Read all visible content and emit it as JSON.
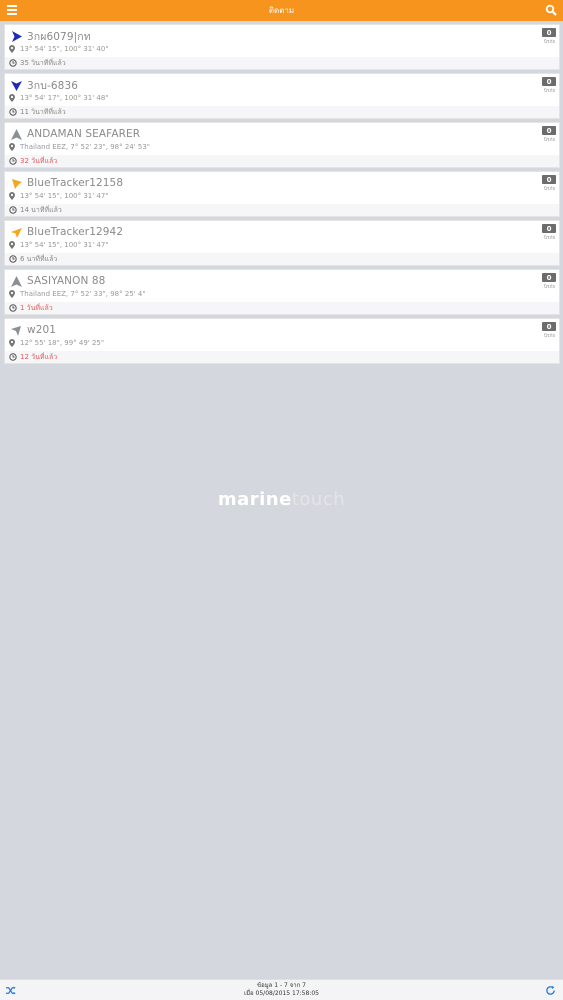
{
  "header": {
    "title": "ติดตาม"
  },
  "vessels": [
    {
      "name": "3กผ6079|กท",
      "position": "13° 54' 15\", 100° 31' 40\"",
      "time": "35 วินาทีที่แล้ว",
      "count": "0",
      "count_label": "นิรภัย",
      "arrow_color": "#1e2bb8",
      "arrow_icon": "arrow-right",
      "time_state": "recent"
    },
    {
      "name": "3กบ-6836",
      "position": "13° 54' 17\", 100° 31' 48\"",
      "time": "11 วินาทีที่แล้ว",
      "count": "0",
      "count_label": "นิรภัย",
      "arrow_color": "#1e2bb8",
      "arrow_icon": "arrow-down",
      "time_state": "recent"
    },
    {
      "name": "ANDAMAN SEAFARER",
      "position": "Thailand EEZ, 7° 52' 23\", 98° 24' 53\"",
      "time": "32 วันที่แล้ว",
      "count": "0",
      "count_label": "นิรภัย",
      "arrow_color": "#8a8f96",
      "arrow_icon": "arrow-up",
      "time_state": "old"
    },
    {
      "name": "BlueTracker12158",
      "position": "13° 54' 15\", 100° 31' 47\"",
      "time": "14 นาทีที่แล้ว",
      "count": "0",
      "count_label": "นิรภัย",
      "arrow_color": "#f2a81e",
      "arrow_icon": "arrow-up-left",
      "time_state": "recent"
    },
    {
      "name": "BlueTracker12942",
      "position": "13° 54' 15\", 100° 31' 47\"",
      "time": "6 นาทีที่แล้ว",
      "count": "0",
      "count_label": "นิรภัย",
      "arrow_color": "#f2a81e",
      "arrow_icon": "arrow-down-left",
      "time_state": "recent"
    },
    {
      "name": "SASIYANON 88",
      "position": "Thailand EEZ, 7° 52' 33\", 98° 25' 4\"",
      "time": "1 วันที่แล้ว",
      "count": "0",
      "count_label": "นิรภัย",
      "arrow_color": "#8a8f96",
      "arrow_icon": "arrow-up",
      "time_state": "old"
    },
    {
      "name": "w201",
      "position": "12° 55' 18\", 99° 49' 25\"",
      "time": "12 วันที่แล้ว",
      "count": "0",
      "count_label": "นิรภัย",
      "arrow_color": "#8a8f96",
      "arrow_icon": "arrow-up-right",
      "time_state": "old"
    }
  ],
  "watermark": {
    "part1": "marine",
    "part2": "touch"
  },
  "footer": {
    "range": "ข้อมูล 1 - 7 จาก 7",
    "updated": "เมื่อ 05/08/2015 17:58:05"
  },
  "colors": {
    "accent": "#f7941d",
    "old_time": "#e25b5b",
    "navy_arrow": "#1e2bb8",
    "orange_arrow": "#f2a81e"
  }
}
